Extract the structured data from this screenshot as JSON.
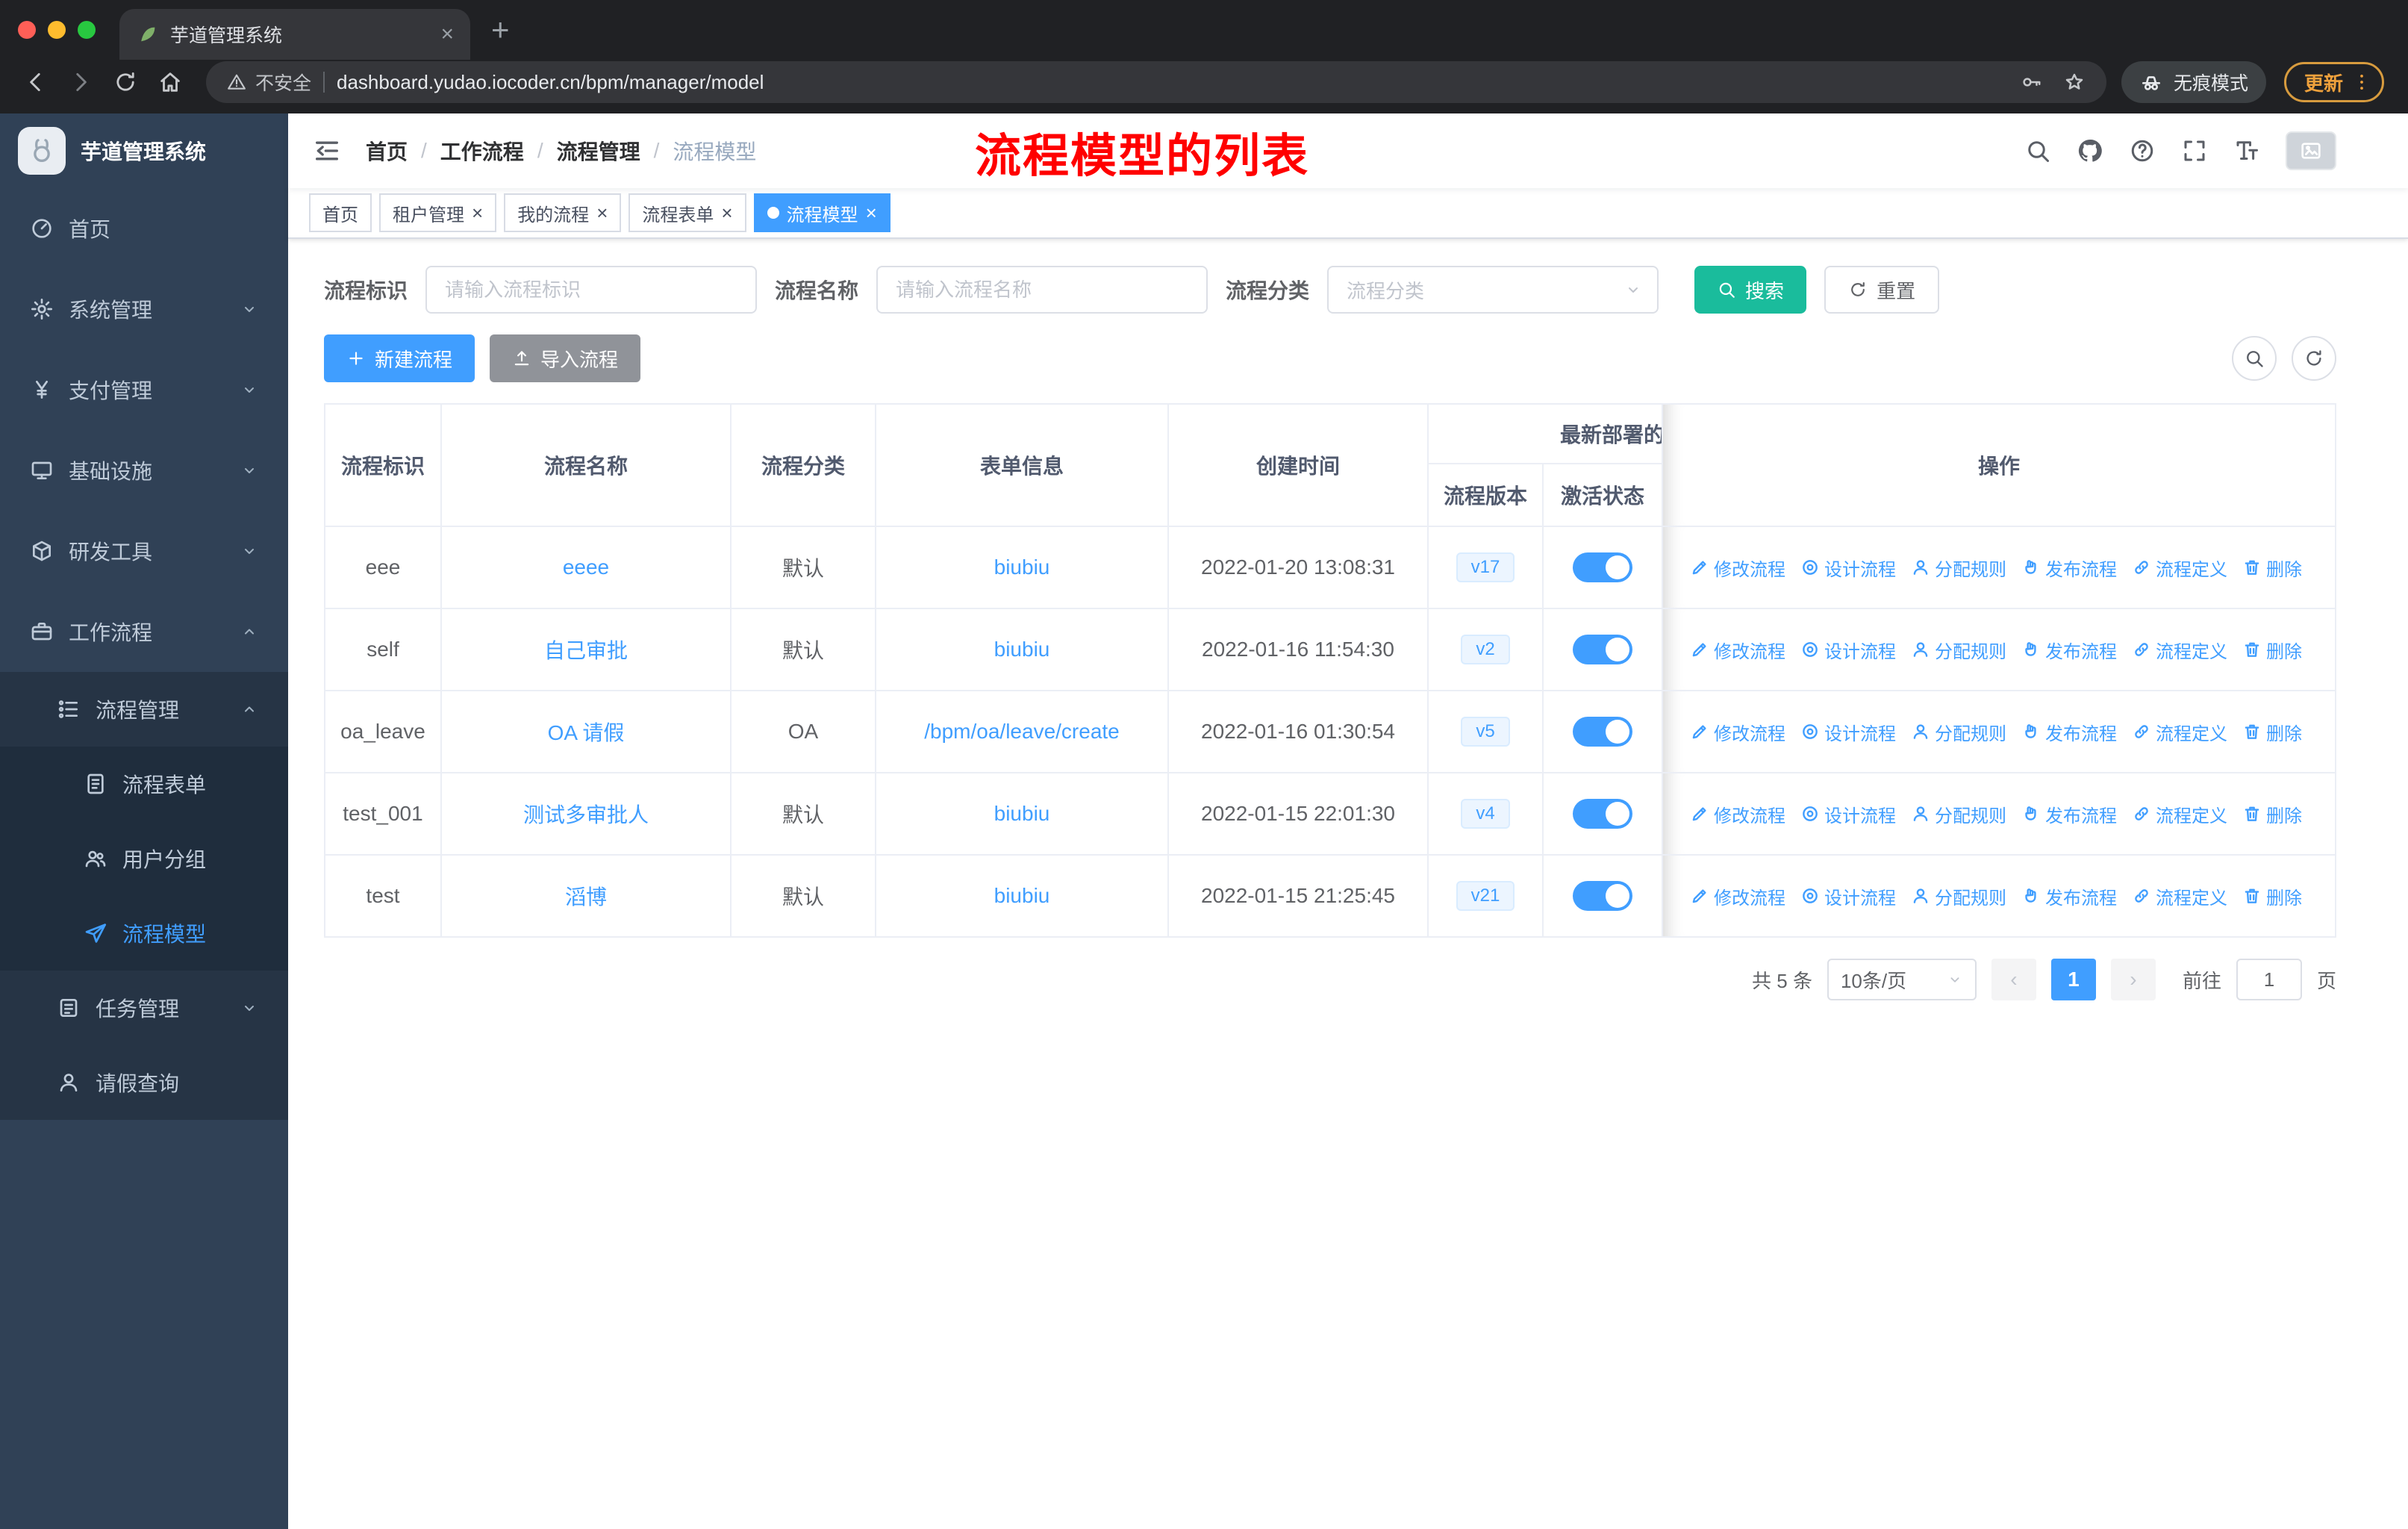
{
  "browser": {
    "tab": {
      "title": "芋道管理系统"
    },
    "address": {
      "security": "不安全",
      "url": "dashboard.yudao.iocoder.cn/bpm/manager/model"
    },
    "incognito": "无痕模式",
    "update": "更新"
  },
  "sidebar": {
    "title": "芋道管理系统",
    "menu": [
      {
        "label": "首页",
        "icon": "dashboard-icon"
      },
      {
        "label": "系统管理",
        "icon": "gear-icon"
      },
      {
        "label": "支付管理",
        "icon": "yen-icon"
      },
      {
        "label": "基础设施",
        "icon": "monitor-icon"
      },
      {
        "label": "研发工具",
        "icon": "cube-icon"
      },
      {
        "label": "工作流程",
        "icon": "briefcase-icon"
      },
      {
        "label": "流程管理",
        "icon": "tree-icon"
      },
      {
        "label": "流程表单",
        "icon": "document-icon"
      },
      {
        "label": "用户分组",
        "icon": "users-icon"
      },
      {
        "label": "流程模型",
        "icon": "paper-plane-icon"
      },
      {
        "label": "任务管理",
        "icon": "clipboard-icon"
      },
      {
        "label": "请假查询",
        "icon": "person-icon"
      }
    ]
  },
  "header": {
    "breadcrumb": [
      "首页",
      "工作流程",
      "流程管理",
      "流程模型"
    ],
    "annotation": "流程模型的列表"
  },
  "tags": [
    {
      "label": "首页",
      "closable": false,
      "active": false
    },
    {
      "label": "租户管理",
      "closable": true,
      "active": false
    },
    {
      "label": "我的流程",
      "closable": true,
      "active": false
    },
    {
      "label": "流程表单",
      "closable": true,
      "active": false
    },
    {
      "label": "流程模型",
      "closable": true,
      "active": true
    }
  ],
  "filters": {
    "key": {
      "label": "流程标识",
      "placeholder": "请输入流程标识",
      "value": ""
    },
    "name": {
      "label": "流程名称",
      "placeholder": "请输入流程名称",
      "value": ""
    },
    "category": {
      "label": "流程分类",
      "placeholder": "流程分类",
      "value": ""
    },
    "search": "搜索",
    "reset": "重置"
  },
  "toolbar": {
    "create": "新建流程",
    "import": "导入流程"
  },
  "table": {
    "headers": {
      "key": "流程标识",
      "name": "流程名称",
      "category": "流程分类",
      "form": "表单信息",
      "created": "创建时间",
      "deploy_group": "最新部署的",
      "version": "流程版本",
      "active": "激活状态",
      "actions": "操作"
    },
    "actions": [
      {
        "label": "修改流程",
        "icon": "edit-icon"
      },
      {
        "label": "设计流程",
        "icon": "design-icon"
      },
      {
        "label": "分配规则",
        "icon": "assign-icon"
      },
      {
        "label": "发布流程",
        "icon": "publish-icon"
      },
      {
        "label": "流程定义",
        "icon": "definition-icon"
      },
      {
        "label": "删除",
        "icon": "delete-icon"
      }
    ],
    "rows": [
      {
        "key": "eee",
        "name": "eeee",
        "category": "默认",
        "form": "biubiu",
        "created": "2022-01-20 13:08:31",
        "version": "v17",
        "active": true
      },
      {
        "key": "self",
        "name": "自己审批",
        "category": "默认",
        "form": "biubiu",
        "created": "2022-01-16 11:54:30",
        "version": "v2",
        "active": true
      },
      {
        "key": "oa_leave",
        "name": "OA 请假",
        "category": "OA",
        "form": "/bpm/oa/leave/create",
        "created": "2022-01-16 01:30:54",
        "version": "v5",
        "active": true
      },
      {
        "key": "test_001",
        "name": "测试多审批人",
        "category": "默认",
        "form": "biubiu",
        "created": "2022-01-15 22:01:30",
        "version": "v4",
        "active": true
      },
      {
        "key": "test",
        "name": "滔博",
        "category": "默认",
        "form": "biubiu",
        "created": "2022-01-15 21:25:45",
        "version": "v21",
        "active": true
      }
    ]
  },
  "pagination": {
    "total": "共 5 条",
    "page_size": "10条/页",
    "current": "1",
    "goto_label": "前往",
    "goto_value": "1",
    "page_suffix": "页"
  },
  "colors": {
    "primary": "#409eff",
    "search_button": "#1abc9c",
    "annotation": "#ff0000",
    "sidebar_bg": "#304156",
    "submenu_bg": "#1f2d3d",
    "tag_active": "#409eff",
    "version_badge_bg": "#ecf5ff"
  }
}
